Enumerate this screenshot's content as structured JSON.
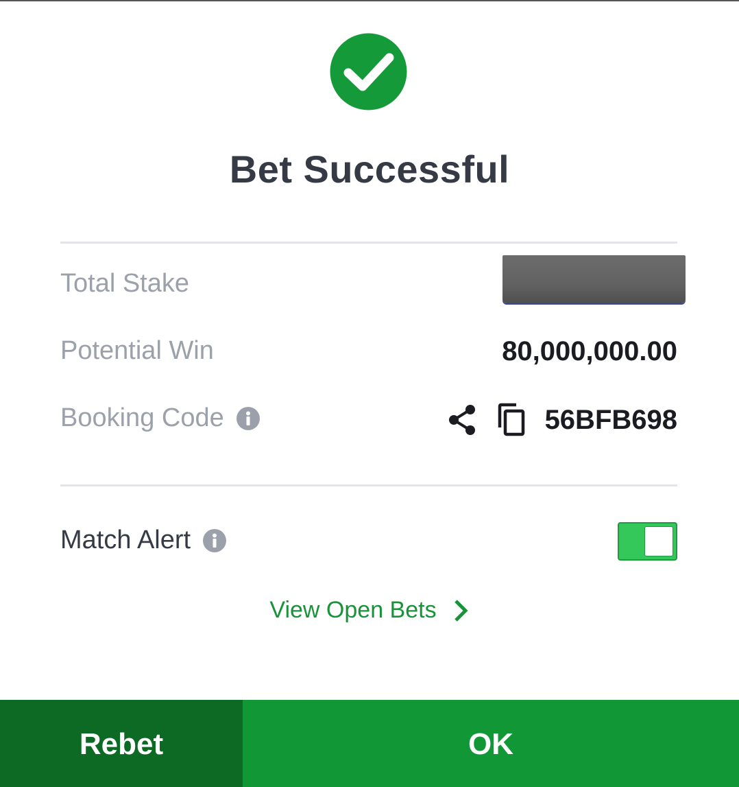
{
  "colors": {
    "accent_green": "#119735",
    "dark_green": "#0c6a24",
    "link_green": "#18933a",
    "toggle_on": "#34c759",
    "title_text": "#353a45",
    "label_text": "#9ca0aa"
  },
  "header": {
    "icon": "check-circle-icon",
    "title": "Bet Successful"
  },
  "summary": {
    "total_stake_label": "Total Stake",
    "total_stake_value_redacted": true,
    "potential_win_label": "Potential Win",
    "potential_win_value": "80,000,000.00",
    "booking_code_label": "Booking Code",
    "booking_code_value": "56BFB698",
    "booking_code_icons": [
      "info-icon",
      "share-icon",
      "copy-icon"
    ]
  },
  "match_alert": {
    "label": "Match Alert",
    "enabled": true
  },
  "links": {
    "view_open_bets": "View Open Bets"
  },
  "actions": {
    "rebet_label": "Rebet",
    "ok_label": "OK"
  }
}
